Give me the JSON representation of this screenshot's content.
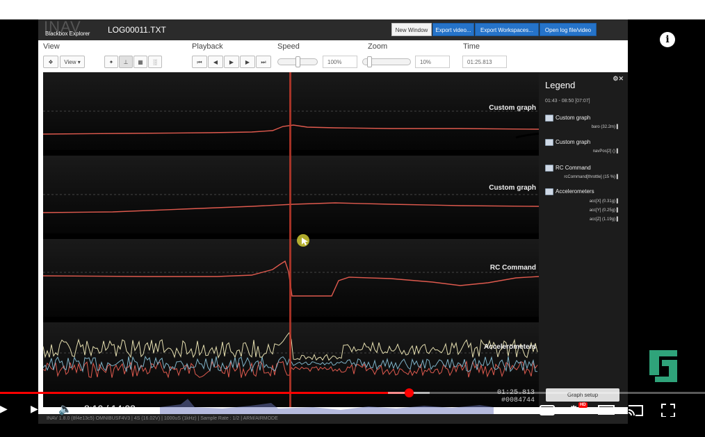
{
  "app": {
    "brand_logo": "INAV",
    "brand_name": "Blackbox Explorer",
    "filename": "LOG00011.TXT",
    "header_buttons": [
      "New Window",
      "Export video...",
      "Export Workspaces...",
      "Open log file/video"
    ]
  },
  "toolbar": {
    "view_label": "View",
    "view_dropdown": "View ▾",
    "playback_label": "Playback",
    "speed_label": "Speed",
    "speed_value": "100%",
    "zoom_label": "Zoom",
    "zoom_value": "10%",
    "time_label": "Time",
    "time_value": "01:25.813",
    "speed_level": 0.5,
    "zoom_level": 0.1
  },
  "graphs": [
    {
      "title": "Custom graph"
    },
    {
      "title": "Custom graph"
    },
    {
      "title": "RC Command"
    },
    {
      "title": "Accelerometers"
    }
  ],
  "readout": {
    "time": "01:25.813",
    "frame": "#0084744"
  },
  "legend": {
    "title": "Legend",
    "close": "⚙✕",
    "range": "01:43 - 08:50 [07:07]",
    "groups": [
      {
        "name": "Custom graph",
        "fields": [
          {
            "label": "baro (32.2m)",
            "color": "#e05a4e"
          }
        ]
      },
      {
        "name": "Custom graph",
        "fields": [
          {
            "label": "navPos[2] ()",
            "color": "#e05a4e"
          }
        ]
      },
      {
        "name": "RC Command",
        "fields": [
          {
            "label": "rcCommand[throttle] (15 %)",
            "color": "#e05a4e"
          }
        ]
      },
      {
        "name": "Accelerometers",
        "fields": [
          {
            "label": "acc[X] (0.31g)",
            "color": "#e05a4e"
          },
          {
            "label": "acc[Y] (0.25g)",
            "color": "#7fb3c8"
          },
          {
            "label": "acc[Z] (1.19g)",
            "color": "#e6dfb0"
          }
        ]
      }
    ],
    "setup_button": "Graph setup"
  },
  "statusbar": "INAV 1.8.0 (8f4e13c5) OMNIBUSF4V3 | 4S (16.02V) | 1000uS (1kHz) | Sample Rate : 1/2 | ARM/AIRMODE",
  "player": {
    "time": "8:10 / 14:03",
    "progress_fraction": 0.58,
    "cc_label": "CC",
    "hd_label": "HD",
    "info_label": "i"
  }
}
